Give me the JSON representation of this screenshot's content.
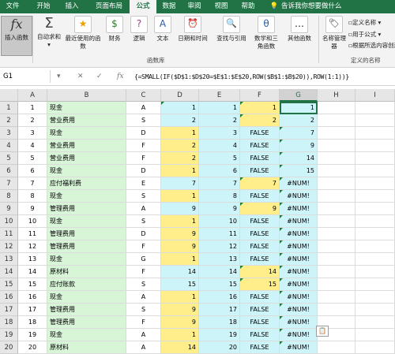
{
  "ribbon_tabs": [
    "文件",
    "开始",
    "插入",
    "页面布局",
    "公式",
    "数据",
    "审阅",
    "视图",
    "帮助",
    "告诉我你想要做什么"
  ],
  "active_tab": "公式",
  "ribbon_buttons": [
    "插入函数",
    "自动求和",
    "最近使用的函数",
    "财务",
    "逻辑",
    "文本",
    "日期和时间",
    "查找与引用",
    "数学和三角函数",
    "其他函数",
    "名称管理器"
  ],
  "ribbon_icons": {
    "insert_function": "fx",
    "autosum": "Σ",
    "finance": "$",
    "logic": "?",
    "text": "A",
    "datetime": "⏰",
    "lookup": "🔍",
    "math": "θ",
    "more": "…",
    "name_mgr": "🏷"
  },
  "side_items": [
    "定义名称",
    "用于公式",
    "根据所选内容创建"
  ],
  "group_labels": {
    "function_library": "函数库",
    "defined_names": "定义的名称"
  },
  "name_box": "G1",
  "formula_bar": {
    "cancel": "✕",
    "enter": "✓",
    "fx": "fx",
    "formula": "{=SMALL(IF($D$1:$D$20=$E$1:$E$20,ROW($B$1:$B$20)),ROW(1:1))}"
  },
  "columns": [
    "A",
    "B",
    "C",
    "D",
    "E",
    "F",
    "G",
    "H",
    "I"
  ],
  "rows": [
    {
      "n": "1",
      "a": "1",
      "b": "现金",
      "c": "A",
      "d": "1",
      "e": "1",
      "f": "1",
      "g": "1"
    },
    {
      "n": "2",
      "a": "2",
      "b": "营业费用",
      "c": "S",
      "d": "2",
      "e": "2",
      "f": "2",
      "g": "2"
    },
    {
      "n": "3",
      "a": "3",
      "b": "现金",
      "c": "D",
      "d": "1",
      "e": "3",
      "f": "FALSE",
      "g": "7"
    },
    {
      "n": "4",
      "a": "4",
      "b": "营业费用",
      "c": "F",
      "d": "2",
      "e": "4",
      "f": "FALSE",
      "g": "9"
    },
    {
      "n": "5",
      "a": "5",
      "b": "营业费用",
      "c": "F",
      "d": "2",
      "e": "5",
      "f": "FALSE",
      "g": "14"
    },
    {
      "n": "6",
      "a": "6",
      "b": "现金",
      "c": "D",
      "d": "1",
      "e": "6",
      "f": "FALSE",
      "g": "15"
    },
    {
      "n": "7",
      "a": "7",
      "b": "应付福利费",
      "c": "E",
      "d": "7",
      "e": "7",
      "f": "7",
      "g": "#NUM!"
    },
    {
      "n": "8",
      "a": "8",
      "b": "现金",
      "c": "S",
      "d": "1",
      "e": "8",
      "f": "FALSE",
      "g": "#NUM!"
    },
    {
      "n": "9",
      "a": "9",
      "b": "管理费用",
      "c": "A",
      "d": "9",
      "e": "9",
      "f": "9",
      "g": "#NUM!"
    },
    {
      "n": "10",
      "a": "10",
      "b": "现金",
      "c": "S",
      "d": "1",
      "e": "10",
      "f": "FALSE",
      "g": "#NUM!"
    },
    {
      "n": "11",
      "a": "11",
      "b": "管理费用",
      "c": "D",
      "d": "9",
      "e": "11",
      "f": "FALSE",
      "g": "#NUM!"
    },
    {
      "n": "12",
      "a": "12",
      "b": "管理费用",
      "c": "F",
      "d": "9",
      "e": "12",
      "f": "FALSE",
      "g": "#NUM!"
    },
    {
      "n": "13",
      "a": "13",
      "b": "现金",
      "c": "G",
      "d": "1",
      "e": "13",
      "f": "FALSE",
      "g": "#NUM!"
    },
    {
      "n": "14",
      "a": "14",
      "b": "原材料",
      "c": "F",
      "d": "14",
      "e": "14",
      "f": "14",
      "g": "#NUM!"
    },
    {
      "n": "15",
      "a": "15",
      "b": "应付账款",
      "c": "S",
      "d": "15",
      "e": "15",
      "f": "15",
      "g": "#NUM!"
    },
    {
      "n": "16",
      "a": "16",
      "b": "现金",
      "c": "A",
      "d": "1",
      "e": "16",
      "f": "FALSE",
      "g": "#NUM!"
    },
    {
      "n": "17",
      "a": "17",
      "b": "管理费用",
      "c": "S",
      "d": "9",
      "e": "17",
      "f": "FALSE",
      "g": "#NUM!"
    },
    {
      "n": "18",
      "a": "18",
      "b": "管理费用",
      "c": "F",
      "d": "9",
      "e": "18",
      "f": "FALSE",
      "g": "#NUM!"
    },
    {
      "n": "19",
      "a": "19",
      "b": "现金",
      "c": "A",
      "d": "1",
      "e": "19",
      "f": "FALSE",
      "g": "#NUM!"
    },
    {
      "n": "20",
      "a": "20",
      "b": "原材料",
      "c": "A",
      "d": "14",
      "e": "20",
      "f": "FALSE",
      "g": "#NUM!"
    }
  ],
  "colors": {
    "ribbon": "#217346",
    "green": "#d8f5d8",
    "yellow": "#ffee8a",
    "cyan": "#cdf4f8"
  }
}
